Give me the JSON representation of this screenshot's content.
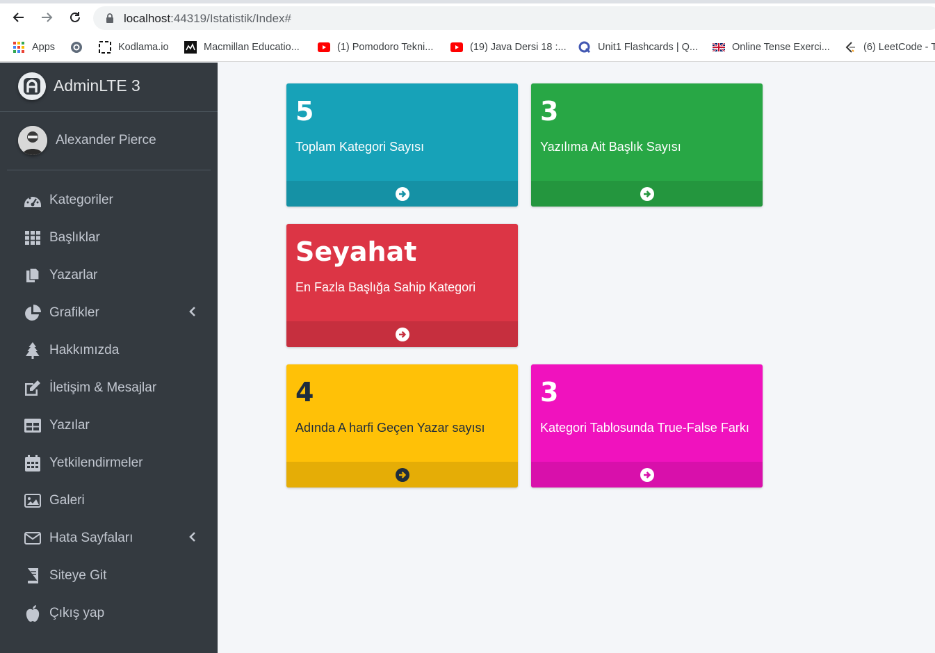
{
  "browser": {
    "url_host": "localhost",
    "url_path": ":44319/Istatistik/Index#",
    "bookmarks": [
      {
        "label": "Apps",
        "icon": "apps-grid-icon"
      },
      {
        "label": "",
        "icon": "circle-logo-icon"
      },
      {
        "label": "Kodlama.io",
        "icon": "kodlama-icon"
      },
      {
        "label": "Macmillan Educatio...",
        "icon": "macmillan-icon"
      },
      {
        "label": "(1) Pomodoro Tekni...",
        "icon": "youtube-icon"
      },
      {
        "label": "(19) Java Dersi 18 :...",
        "icon": "youtube-icon"
      },
      {
        "label": "Unit1 Flashcards | Q...",
        "icon": "quizlet-icon"
      },
      {
        "label": "Online Tense Exerci...",
        "icon": "uk-flag-icon"
      },
      {
        "label": "(6) LeetCode - T",
        "icon": "leetcode-icon"
      }
    ]
  },
  "sidebar": {
    "brand": "AdminLTE 3",
    "user": "Alexander Pierce",
    "items": [
      {
        "label": "Kategoriler",
        "icon": "tachometer-icon",
        "has_arrow": false
      },
      {
        "label": "Başlıklar",
        "icon": "grid-icon",
        "has_arrow": false
      },
      {
        "label": "Yazarlar",
        "icon": "copy-icon",
        "has_arrow": false
      },
      {
        "label": "Grafikler",
        "icon": "pie-chart-icon",
        "has_arrow": true
      },
      {
        "label": "Hakkımızda",
        "icon": "tree-icon",
        "has_arrow": false
      },
      {
        "label": "İletişim & Mesajlar",
        "icon": "edit-icon",
        "has_arrow": false
      },
      {
        "label": "Yazılar",
        "icon": "table-icon",
        "has_arrow": false
      },
      {
        "label": "Yetkilendirmeler",
        "icon": "calendar-icon",
        "has_arrow": false
      },
      {
        "label": "Galeri",
        "icon": "image-icon",
        "has_arrow": false
      },
      {
        "label": "Hata Sayfaları",
        "icon": "envelope-icon",
        "has_arrow": true
      },
      {
        "label": "Siteye Git",
        "icon": "book-icon",
        "has_arrow": false
      },
      {
        "label": "Çıkış yap",
        "icon": "apple-icon",
        "has_arrow": false
      }
    ]
  },
  "boxes": [
    {
      "value": "5",
      "label": "Toplam Kategori Sayısı",
      "color": "#17a2b8",
      "footer_color": "#1591a5",
      "theme": "info"
    },
    {
      "value": "3",
      "label": "Yazılıma Ait Başlık Sayısı",
      "color": "#28a745",
      "footer_color": "#24963e",
      "theme": "success"
    },
    {
      "value": "Seyahat",
      "label": "En Fazla Başlığa Sahip Kategori",
      "color": "#dc3545",
      "footer_color": "#c62f3e",
      "theme": "danger"
    },
    {
      "value": "4",
      "label": "Adında A harfi Geçen Yazar sayısı",
      "color": "#ffc107",
      "footer_color": "#e5ad06",
      "theme": "warning"
    },
    {
      "value": "3",
      "label": "Kategori Tablosunda True-False Farkı",
      "color": "#f012be",
      "footer_color": "#d810ab",
      "theme": "fuchsia"
    }
  ]
}
